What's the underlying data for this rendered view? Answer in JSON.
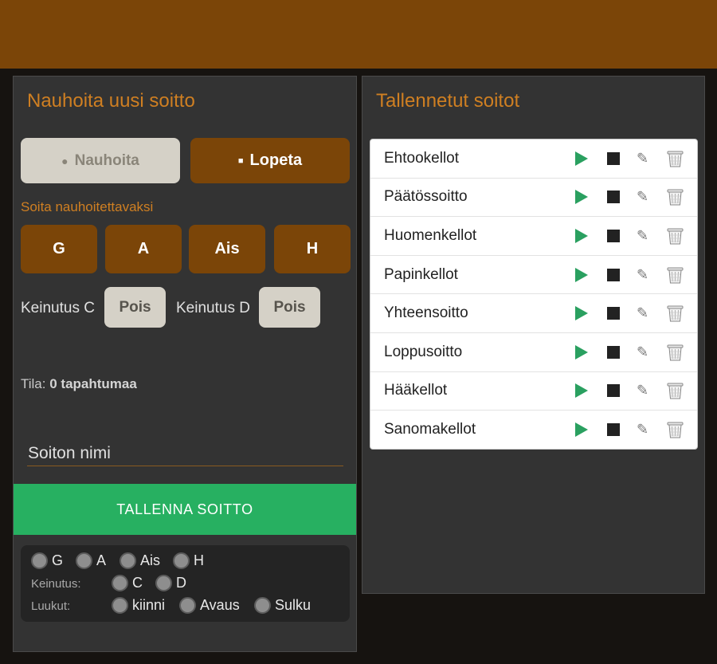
{
  "left_panel": {
    "title": "Nauhoita uusi soitto",
    "record_button": "Nauhoita",
    "stop_button": "Lopeta",
    "play_section_label": "Soita nauhoitettavaksi",
    "bells": [
      "G",
      "A",
      "Ais",
      "H"
    ],
    "swing_c_label": "Keinutus C",
    "swing_c_value": "Pois",
    "swing_d_label": "Keinutus D",
    "swing_d_value": "Pois",
    "status_label": "Tila:",
    "status_value": "0 tapahtumaa",
    "name_placeholder": "Soiton nimi",
    "save_button": "TALLENNA SOITTO",
    "indicators": {
      "bells": [
        "G",
        "A",
        "Ais",
        "H"
      ],
      "swing_label": "Keinutus:",
      "swing": [
        "C",
        "D"
      ],
      "hatches_label": "Luukut:",
      "hatches": [
        "kiinni",
        "Avaus",
        "Sulku"
      ]
    }
  },
  "right_panel": {
    "title": "Tallennetut soitot",
    "recordings": [
      "Ehtookellot",
      "Päätössoitto",
      "Huomenkellot",
      "Papinkellot",
      "Yhteensoitto",
      "Loppusoitto",
      "Hääkellot",
      "Sanomakellot"
    ]
  },
  "icons": {
    "record": "dot-icon",
    "stop": "square-icon",
    "play": "play-icon",
    "edit": "pencil-icon",
    "delete": "trash-icon"
  },
  "colors": {
    "header": "#7b4508",
    "accent": "#cf7f22",
    "brown_button": "#7b4508",
    "save_green": "#27b061",
    "play_green": "#2aa060"
  }
}
